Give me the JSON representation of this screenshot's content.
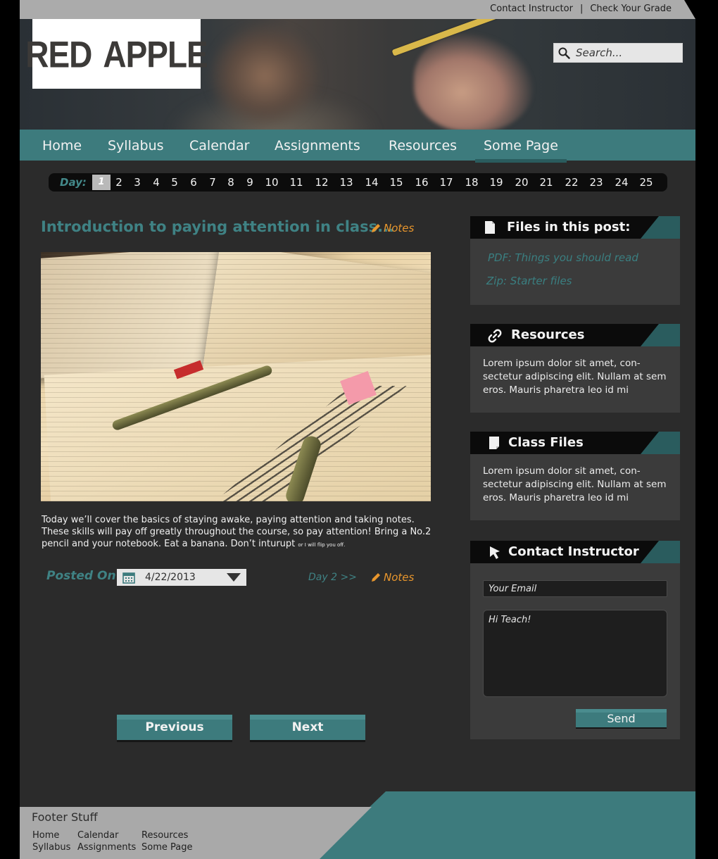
{
  "topbar": {
    "links": [
      "Contact Instructor",
      "Check Your Grade"
    ],
    "separator": "|"
  },
  "brand": {
    "logo_left": "RED",
    "logo_right": "APPLE"
  },
  "search": {
    "placeholder": "Search..."
  },
  "nav": {
    "items": [
      "Home",
      "Syllabus",
      "Calendar",
      "Assignments",
      "Resources",
      "Some Page"
    ],
    "active": "Some Page"
  },
  "day_strip": {
    "label": "Day:",
    "days": [
      "1",
      "2",
      "3",
      "4",
      "5",
      "6",
      "7",
      "8",
      "9",
      "10",
      "11",
      "12",
      "13",
      "14",
      "15",
      "16",
      "17",
      "18",
      "19",
      "20",
      "21",
      "22",
      "23",
      "24",
      "25"
    ],
    "active": "1"
  },
  "post": {
    "title": "Introduction to paying attention in class...",
    "notes_label": "Notes",
    "body": "Today we’ll cover the basics of staying awake, paying attention and taking notes. These skills will pay off greatly throughout the course, so pay attention! Bring a No.2 pencil and your notebook. Eat a banana. Don’t inturupt ",
    "body_small": "or I will flip you off.",
    "posted_label": "Posted On",
    "date": "4/22/2013",
    "next_day_label": "Day 2 >>",
    "previous_label": "Previous",
    "next_label": "Next"
  },
  "sidebar": {
    "files": {
      "title": "Files in this post:",
      "items": [
        "PDF: Things you should read",
        "Zip: Starter files"
      ]
    },
    "resources": {
      "title": "Resources",
      "text": "Lorem ipsum dolor sit amet, con-sectetur adipiscing elit. Nullam at sem eros. Mauris pharetra leo id mi"
    },
    "class_files": {
      "title": "Class Files",
      "text": "Lorem ipsum dolor sit amet, con-sectetur adipiscing elit. Nullam at sem eros. Mauris pharetra leo id mi"
    },
    "contact": {
      "title": "Contact Instructor",
      "email_placeholder": "Your Email",
      "message_placeholder": "Hi Teach!",
      "send_label": "Send"
    }
  },
  "footer": {
    "title": "Footer Stuff",
    "links": [
      "Home",
      "Syllabus",
      "Calendar",
      "Assignments",
      "Resources",
      "Some Page"
    ]
  },
  "colors": {
    "accent": "#3d7b7d",
    "accent_dark": "#2a5c5e",
    "notes": "#e8962d",
    "page_bg": "#2b2b2b"
  }
}
